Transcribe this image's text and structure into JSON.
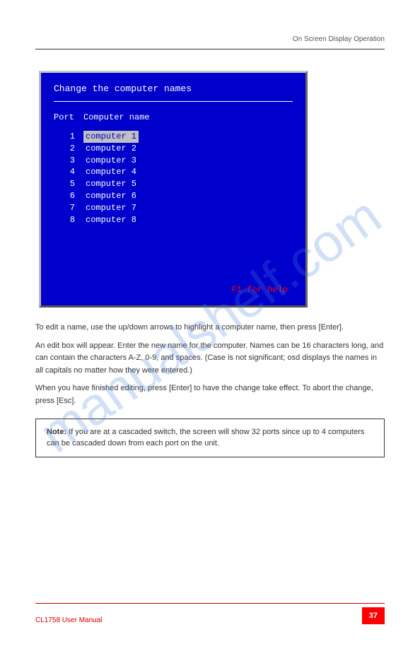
{
  "header": {
    "left": "",
    "right": "On Screen Display Operation"
  },
  "kvm": {
    "title": "Change the computer names",
    "port_header": "Port",
    "name_header": "Computer name",
    "items": [
      {
        "port": "1",
        "name": "computer 1",
        "selected": true
      },
      {
        "port": "2",
        "name": "computer 2",
        "selected": false
      },
      {
        "port": "3",
        "name": "computer 3",
        "selected": false
      },
      {
        "port": "4",
        "name": "computer 4",
        "selected": false
      },
      {
        "port": "5",
        "name": "computer 5",
        "selected": false
      },
      {
        "port": "6",
        "name": "computer 6",
        "selected": false
      },
      {
        "port": "7",
        "name": "computer 7",
        "selected": false
      },
      {
        "port": "8",
        "name": "computer 8",
        "selected": false
      }
    ],
    "help_text": "F1 for help"
  },
  "body": {
    "p1": "To edit a name, use the up/down arrows to highlight a computer name, then press [Enter].",
    "p2": "An edit box will appear. Enter the new name for the computer. Names can be 16 characters long, and can contain the characters A-Z, 0-9, and spaces. (Case is not significant; osd displays the names in all capitals no matter how they were entered.)",
    "p3": "When you have finished editing, press [Enter] to have the change take effect. To abort the change, press [Esc]."
  },
  "note": {
    "label": "Note:",
    "text": "If you are at a cascaded switch, the screen will show 32 ports since up to 4 computers can be cascaded down from each port on the unit."
  },
  "footer": {
    "model": "CL1758",
    "manual": "User Manual"
  },
  "page_number": "37",
  "watermark": "manualshelf.com"
}
